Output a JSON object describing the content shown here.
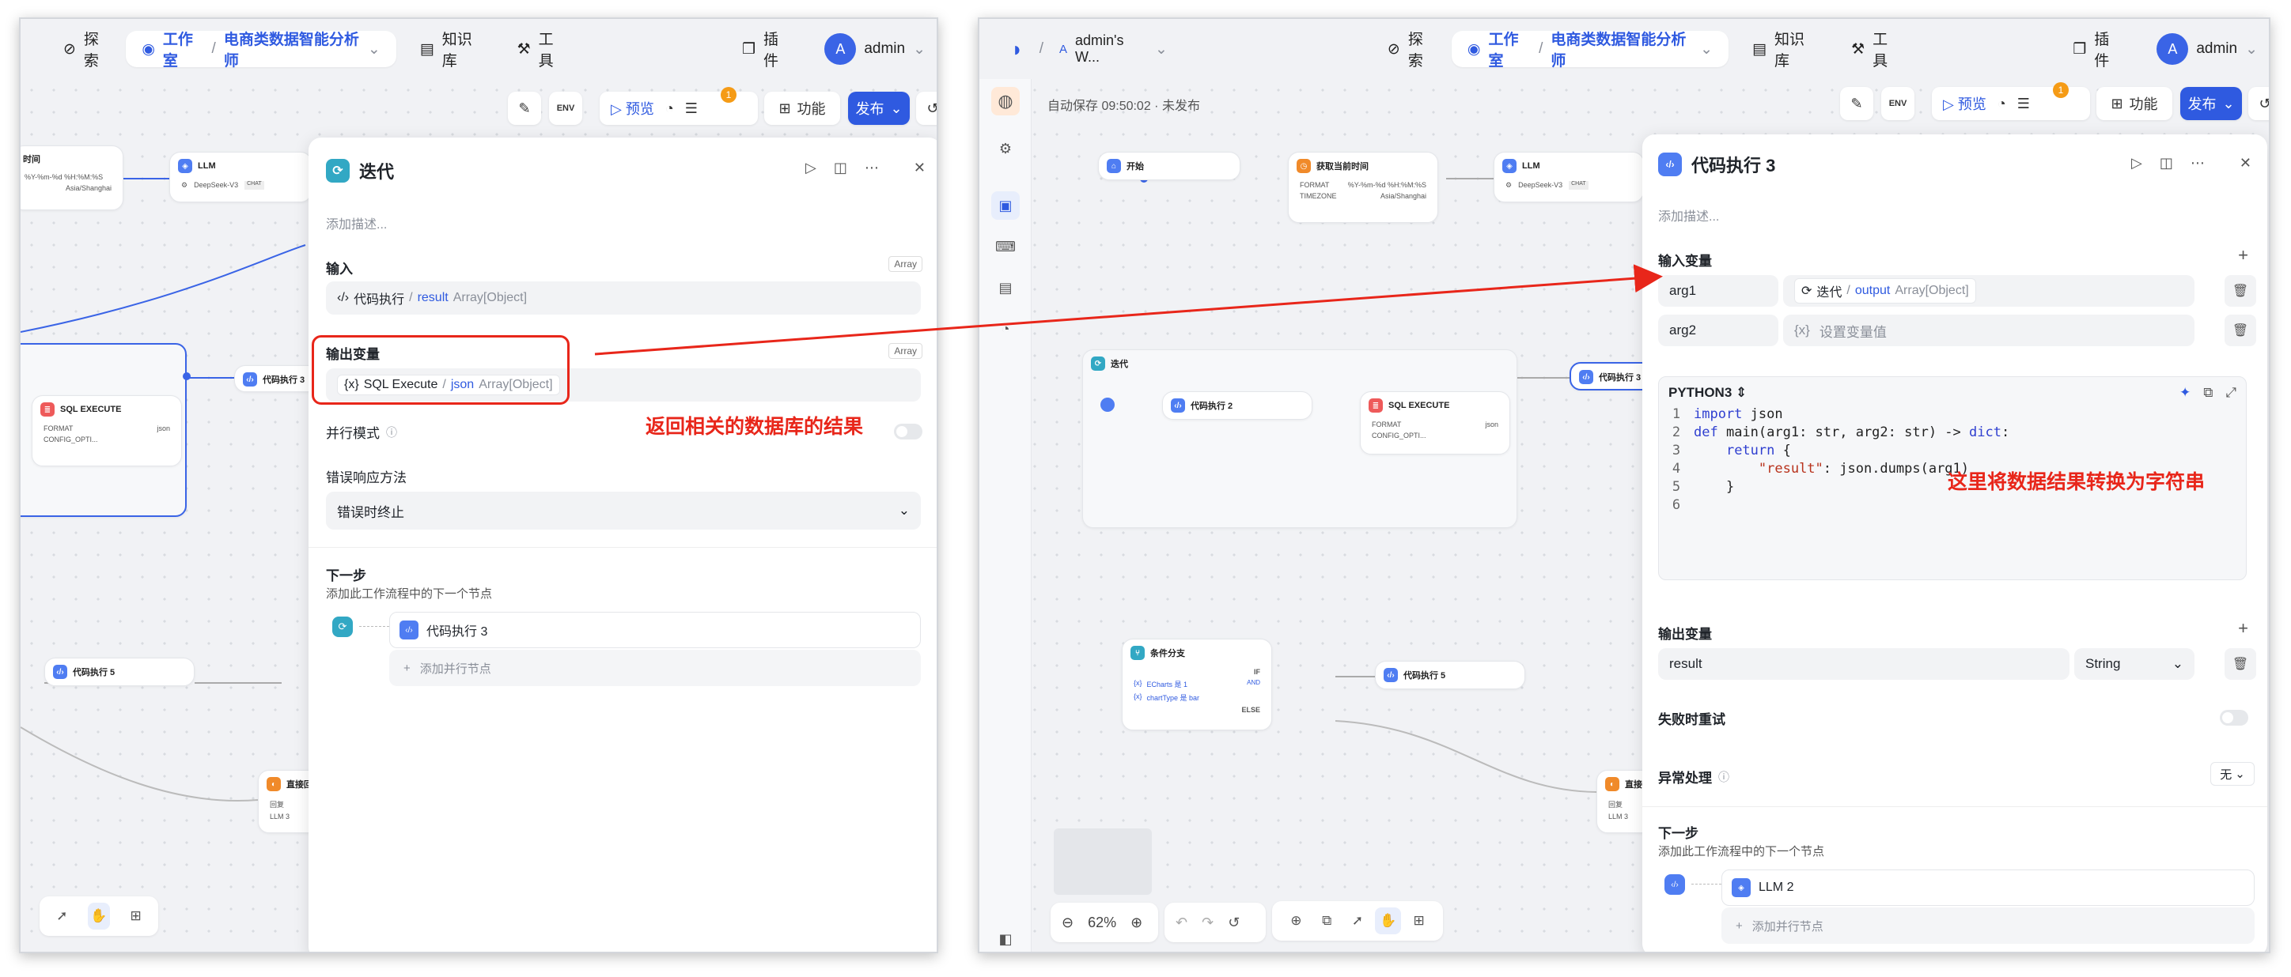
{
  "nav": {
    "explore": "探索",
    "studio": "工作室",
    "app_name": "电商类数据智能分析师",
    "knowledge": "知识库",
    "tools": "工具",
    "plugins": "插件",
    "user": "admin",
    "avatar_letter": "A",
    "workspace": "admin's W..."
  },
  "toolbar": {
    "env": "ENV",
    "preview": "预览",
    "badge_count": "1",
    "features": "功能",
    "publish": "发布",
    "autosave": "自动保存 09:50:02 · 未发布"
  },
  "left_panel": {
    "title": "迭代",
    "desc_placeholder": "添加描述...",
    "input_label": "输入",
    "input_type_badge": "Array",
    "input_src_node": "代码执行",
    "input_var": "result",
    "input_var_type": "Array[Object]",
    "output_label": "输出变量",
    "output_type_badge": "Array",
    "output_src_node": "SQL Execute",
    "output_var": "json",
    "output_var_type": "Array[Object]",
    "parallel_label": "并行模式",
    "error_label": "错误响应方法",
    "error_value": "错误时终止",
    "next_label": "下一步",
    "next_desc": "添加此工作流程中的下一个节点",
    "next_node": "代码执行 3",
    "add_parallel": "添加并行节点"
  },
  "right_panel": {
    "title": "代码执行 3",
    "desc_placeholder": "添加描述...",
    "input_vars_label": "输入变量",
    "arg1_name": "arg1",
    "arg1_src_node": "迭代",
    "arg1_var": "output",
    "arg1_type": "Array[Object]",
    "arg2_name": "arg2",
    "arg2_placeholder": "设置变量值",
    "lang": "PYTHON3",
    "code_lines": [
      "import json",
      "def main(arg1: str, arg2: str) -> dict:",
      "    return {",
      "        \"result\": json.dumps(arg1)",
      "    }",
      ""
    ],
    "output_vars_label": "输出变量",
    "out_name": "result",
    "out_type": "String",
    "retry_label": "失败时重试",
    "exception_label": "异常处理",
    "exception_value": "无",
    "next_label": "下一步",
    "next_desc": "添加此工作流程中的下一个节点",
    "next_node": "LLM 2",
    "add_parallel": "添加并行节点"
  },
  "annotations": {
    "left": "返回相关的数据库的结果",
    "right": "这里将数据结果转换为字符串"
  },
  "canvas_left": {
    "time_title": "时间",
    "time_format": "%Y-%m-%d %H:%M:%S",
    "time_tz": "Asia/Shanghai",
    "llm": "LLM",
    "llm_model": "DeepSeek-V3",
    "chat": "CHAT",
    "code3": "代码执行 3",
    "sql": "SQL EXECUTE",
    "format": "FORMAT",
    "json": "json",
    "config": "CONFIG_OPTI...",
    "code5": "代码执行 5",
    "direct": "直接回",
    "reply": "回复",
    "llm3": "LLM 3"
  },
  "canvas_right": {
    "start": "开始",
    "get_time": "获取当前时间",
    "format": "FORMAT",
    "format_val": "%Y-%m-%d %H:%M:%S",
    "timezone": "TIMEZONE",
    "timezone_val": "Asia/Shanghai",
    "llm": "LLM",
    "llm_model": "DeepSeek-V3",
    "chat": "CHAT",
    "iter": "迭代",
    "code2": "代码执行 2",
    "sql": "SQL EXECUTE",
    "json": "json",
    "config": "CONFIG_OPTI...",
    "code3": "代码执行 3",
    "branch": "条件分支",
    "if": "IF",
    "and": "AND",
    "else": "ELSE",
    "cond1": "ECharts 是 1",
    "cond2": "chartType 是 bar",
    "code5": "代码执行 5",
    "direct": "直接",
    "reply": "回复",
    "llm3": "LLM 3",
    "zoom": "62%"
  }
}
